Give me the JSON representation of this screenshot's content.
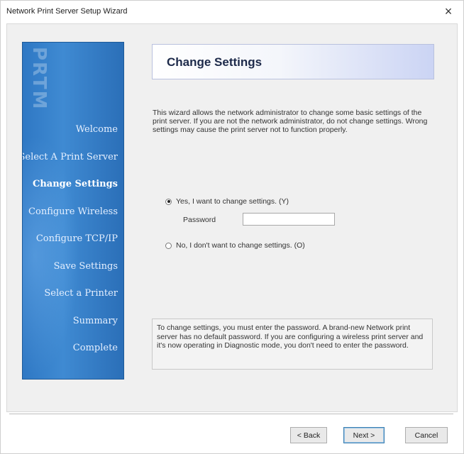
{
  "window": {
    "title": "Network Print Server Setup Wizard",
    "close_glyph": "×"
  },
  "sidebar": {
    "logo_text": "PRTM",
    "steps": [
      {
        "label": "Welcome",
        "active": false
      },
      {
        "label": "Select A Print Server",
        "active": false
      },
      {
        "label": "Change Settings",
        "active": true
      },
      {
        "label": "Configure Wireless",
        "active": false
      },
      {
        "label": "Configure TCP/IP",
        "active": false
      },
      {
        "label": "Save Settings",
        "active": false
      },
      {
        "label": "Select a Printer",
        "active": false
      },
      {
        "label": "Summary",
        "active": false
      },
      {
        "label": "Complete",
        "active": false
      }
    ]
  },
  "main": {
    "header_title": "Change Settings",
    "intro": "This wizard allows the network administrator to change some basic settings of the print server. If you are not the network administrator, do not change settings. Wrong settings may cause the print server not to function properly.",
    "option_yes": "Yes, I want to change settings. (Y)",
    "password_label": "Password",
    "password_value": "",
    "option_no": "No, I don't want to change settings. (O)",
    "note": "To change settings, you must enter the password. A brand-new Network print server has no default password. If you are configuring a wireless print server and it's now operating in Diagnostic mode, you don't need to enter the password."
  },
  "footer": {
    "back_label": "< Back",
    "next_label": "Next >",
    "cancel_label": "Cancel"
  },
  "colors": {
    "sidebar_blue": "#3f8ad2",
    "header_gradient_end": "#cbd4f4"
  }
}
